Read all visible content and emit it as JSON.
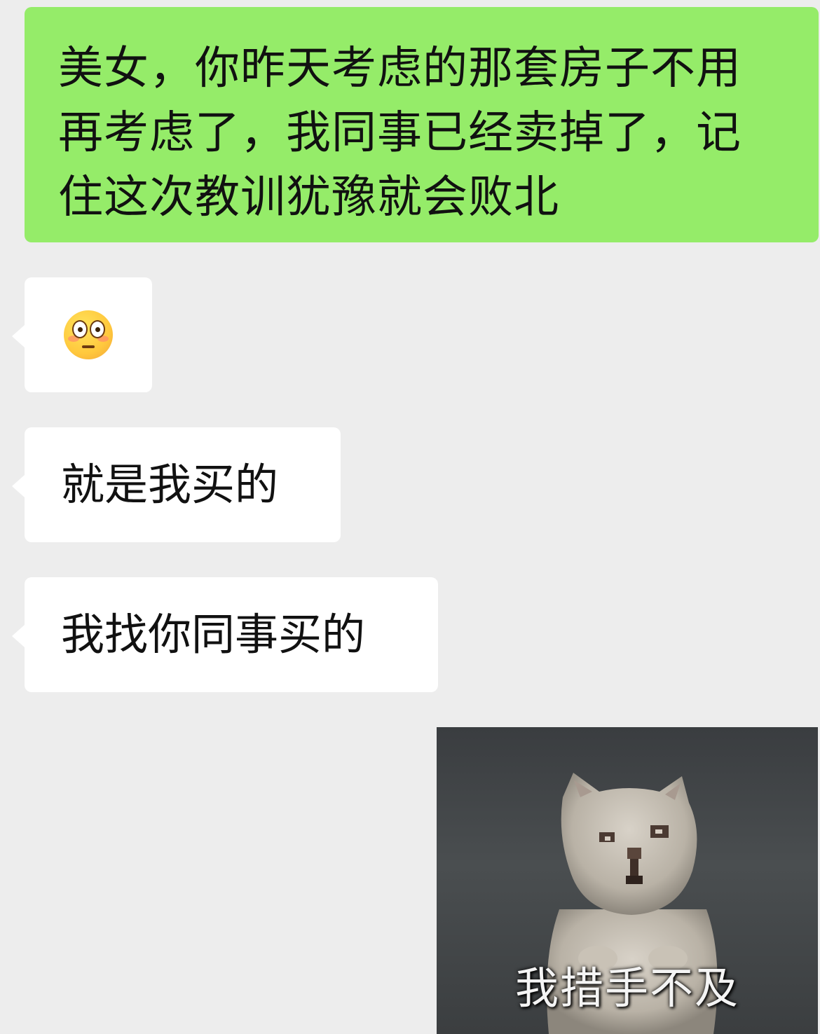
{
  "chat": {
    "messages": [
      {
        "side": "sent",
        "type": "text",
        "lines": [
          "美女，你昨天考虑的那套房子不用",
          "再考虑了，我同事已经卖掉了，记",
          "住这次教训犹豫就会败北"
        ]
      },
      {
        "side": "received",
        "type": "emoji",
        "emoji": "flushed-face-emoji"
      },
      {
        "side": "received",
        "type": "text",
        "text": "就是我买的"
      },
      {
        "side": "received",
        "type": "text",
        "text": "我找你同事买的"
      },
      {
        "side": "sent",
        "type": "sticker",
        "sticker": "cat-meme",
        "caption": "我措手不及"
      }
    ]
  },
  "colors": {
    "sent_bubble": "#95ec69",
    "received_bubble": "#ffffff",
    "background": "#ededed"
  }
}
